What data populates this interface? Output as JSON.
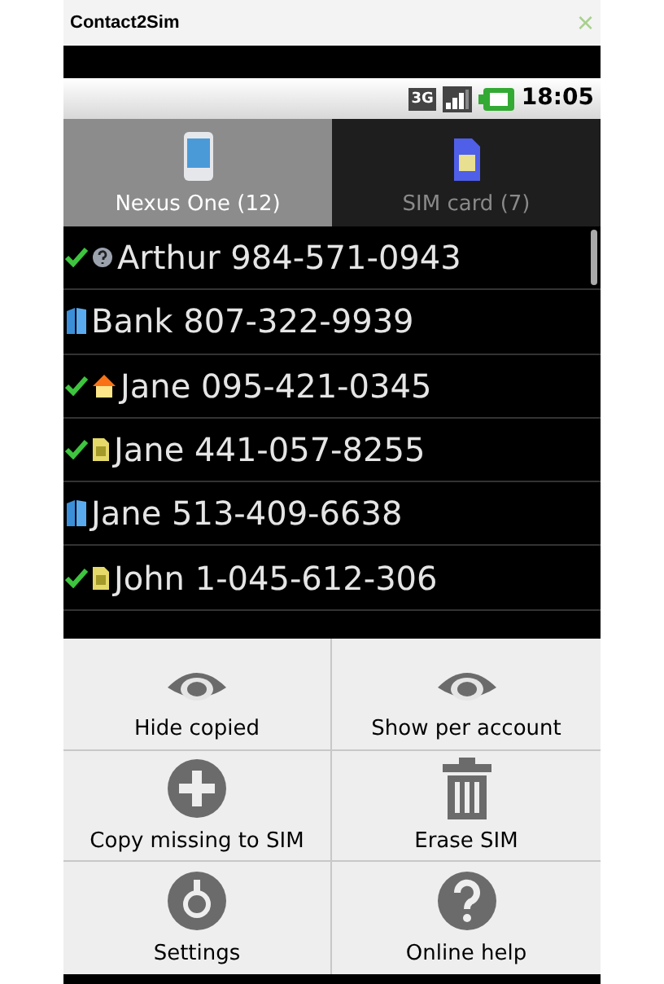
{
  "window": {
    "title": "Contact2Sim",
    "close": "×"
  },
  "status_bar": {
    "network": "3G",
    "time": "18:05"
  },
  "tabs": [
    {
      "label": "Nexus One (12)",
      "kind": "phone",
      "selected": true
    },
    {
      "label": "SIM card (7)",
      "kind": "sim",
      "selected": false
    }
  ],
  "contacts": [
    {
      "text": "Arthur 984-571-0943",
      "checked": true,
      "kind": "unknown"
    },
    {
      "text": "Bank 807-322-9939",
      "checked": false,
      "kind": "account"
    },
    {
      "text": "Jane 095-421-0345",
      "checked": true,
      "kind": "home"
    },
    {
      "text": "Jane 441-057-8255",
      "checked": true,
      "kind": "sim"
    },
    {
      "text": "Jane 513-409-6638",
      "checked": false,
      "kind": "account"
    },
    {
      "text": "John 1-045-612-306",
      "checked": true,
      "kind": "sim"
    }
  ],
  "menu": [
    {
      "label": "Hide copied",
      "kind": "eye"
    },
    {
      "label": "Show per account",
      "kind": "eye"
    },
    {
      "label": "Copy missing to SIM",
      "kind": "plus"
    },
    {
      "label": "Erase SIM",
      "kind": "trash"
    },
    {
      "label": "Settings",
      "kind": "gear"
    },
    {
      "label": "Online help",
      "kind": "help"
    }
  ]
}
